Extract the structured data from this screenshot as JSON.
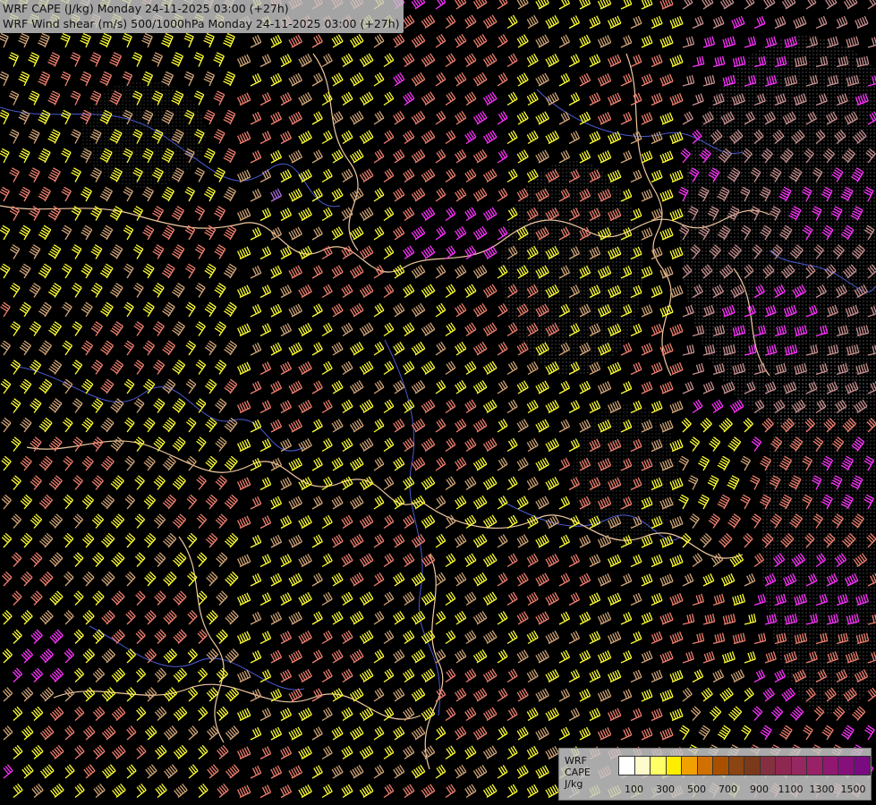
{
  "titles": {
    "line1": "WRF CAPE (J/kg) Monday 24-11-2025 03:00 (+27h)",
    "line2": "WRF Wind shear (m/s) 500/1000hPa Monday 24-11-2025 03:00 (+27h)"
  },
  "legend": {
    "label_lines": [
      "WRF",
      "CAPE",
      "J/kg"
    ],
    "swatch_colors": [
      "#ffffff",
      "#fffacc",
      "#ffff66",
      "#ffee00",
      "#f0a000",
      "#d07000",
      "#a85000",
      "#8b4513",
      "#7a3a1a",
      "#843040",
      "#8f2850",
      "#952860",
      "#9a2068",
      "#901870",
      "#85107a",
      "#7a0a80"
    ],
    "tick_labels": [
      "100",
      "300",
      "500",
      "700",
      "900",
      "1100",
      "1300",
      "1500"
    ]
  },
  "colors": {
    "background": "#000000",
    "barb_yellow": "#ffff33",
    "barb_tan": "#d2a679",
    "barb_salmon": "#f08070",
    "barb_magenta": "#ff33ff",
    "barb_purple": "#b070e0",
    "barb_rose": "#c99090",
    "border_line": "#f0c8a0",
    "coast_line": "#4a5ad0",
    "stipple": "#9a9a9a"
  },
  "icons": {
    "wind_barb": "wind-barb-icon"
  }
}
